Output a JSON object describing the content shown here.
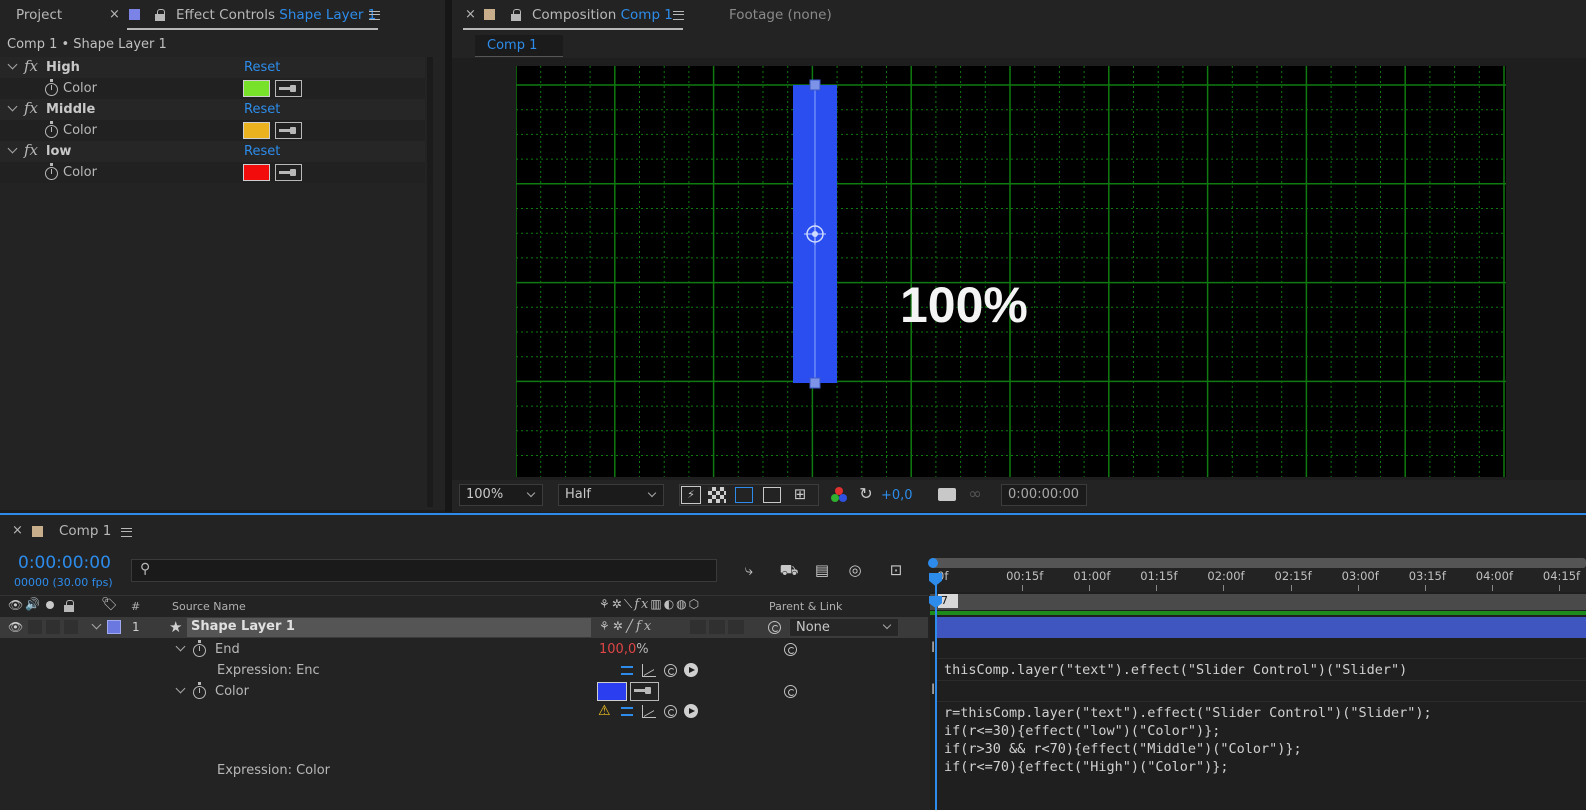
{
  "left_panel": {
    "tab_project": "Project",
    "tab_effect_controls": "Effect Controls",
    "tab_effect_controls_layer": "Shape Layer 1",
    "breadcrumb": "Comp 1 • Shape Layer 1",
    "effects": [
      {
        "name": "High",
        "reset": "Reset",
        "prop": "Color",
        "color": "#78e22a"
      },
      {
        "name": "Middle",
        "reset": "Reset",
        "prop": "Color",
        "color": "#eab21e"
      },
      {
        "name": "low",
        "reset": "Reset",
        "prop": "Color",
        "color": "#f20c0c"
      }
    ],
    "fx_symbol": "fx"
  },
  "comp_panel": {
    "tab_label": "Composition",
    "tab_comp_name": "Comp 1",
    "footage_tab": "Footage",
    "footage_value": "(none)",
    "subtab": "Comp 1",
    "overlay_text": "100%",
    "zoom": "100%",
    "resolution": "Half",
    "exposure": "+0,0",
    "timecode": "0:00:00:00",
    "bar_color": "#2a4ef0",
    "grid_color": "#0f7a0f"
  },
  "timeline": {
    "tab": "Comp 1",
    "timecode": "0:00:00:00",
    "frame_info": "00000 (30.00 fps)",
    "search_placeholder": "",
    "columns": {
      "num": "#",
      "source_name": "Source Name",
      "parent_link": "Parent & Link"
    },
    "ruler": [
      "0f",
      "00:15f",
      "01:00f",
      "01:15f",
      "02:00f",
      "02:15f",
      "03:00f",
      "03:15f",
      "04:00f",
      "04:15f"
    ],
    "marker": "7",
    "layer": {
      "number": "1",
      "name": "Shape Layer 1",
      "parent": "None",
      "label_color": "#6a78e0"
    },
    "props": {
      "end_label": "End",
      "end_value": "100,0",
      "end_unit": "%",
      "expr_end_label": "Expression: Enc",
      "color_label": "Color",
      "color_value": "#2c3ff0",
      "expr_color_label": "Expression: Color"
    },
    "expressions": {
      "end": "thisComp.layer(\"text\").effect(\"Slider Control\")(\"Slider\")",
      "color_lines": [
        "r=thisComp.layer(\"text\").effect(\"Slider Control\")(\"Slider\");",
        "if(r<=30){effect(\"low\")(\"Color\")};",
        "if(r>30 && r<70){effect(\"Middle\")(\"Color\")};",
        "if(r<=70){effect(\"High\")(\"Color\")};"
      ]
    }
  }
}
